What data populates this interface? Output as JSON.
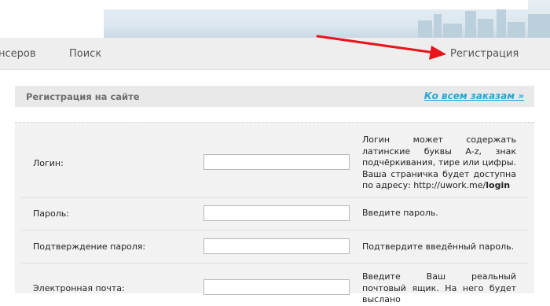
{
  "nav": {
    "items": [
      {
        "label": "нсеров"
      },
      {
        "label": "Поиск"
      }
    ],
    "register": "Регистрация"
  },
  "panel": {
    "title": "Регистрация на сайте",
    "link": "Ко всем заказам »"
  },
  "form": {
    "login": {
      "label": "Логин:",
      "value": "",
      "hint_text": "Логин может содержать латинские буквы A-z, знак подчёркивания, тире или цифры. Ваша страничка будет доступна по адресу: http://uwork.me/",
      "hint_bold": "login"
    },
    "password": {
      "label": "Пароль:",
      "value": "",
      "hint": "Введите пароль."
    },
    "confirm": {
      "label": "Подтверждение пароля:",
      "value": "",
      "hint": "Подтвердите введённый пароль."
    },
    "email": {
      "label": "Электронная почта:",
      "value": "",
      "hint": "Введите Ваш реальный почтовый ящик. На него будет выслано"
    }
  },
  "colors": {
    "annotation_arrow": "#e8141b",
    "link": "#29a6d6"
  }
}
